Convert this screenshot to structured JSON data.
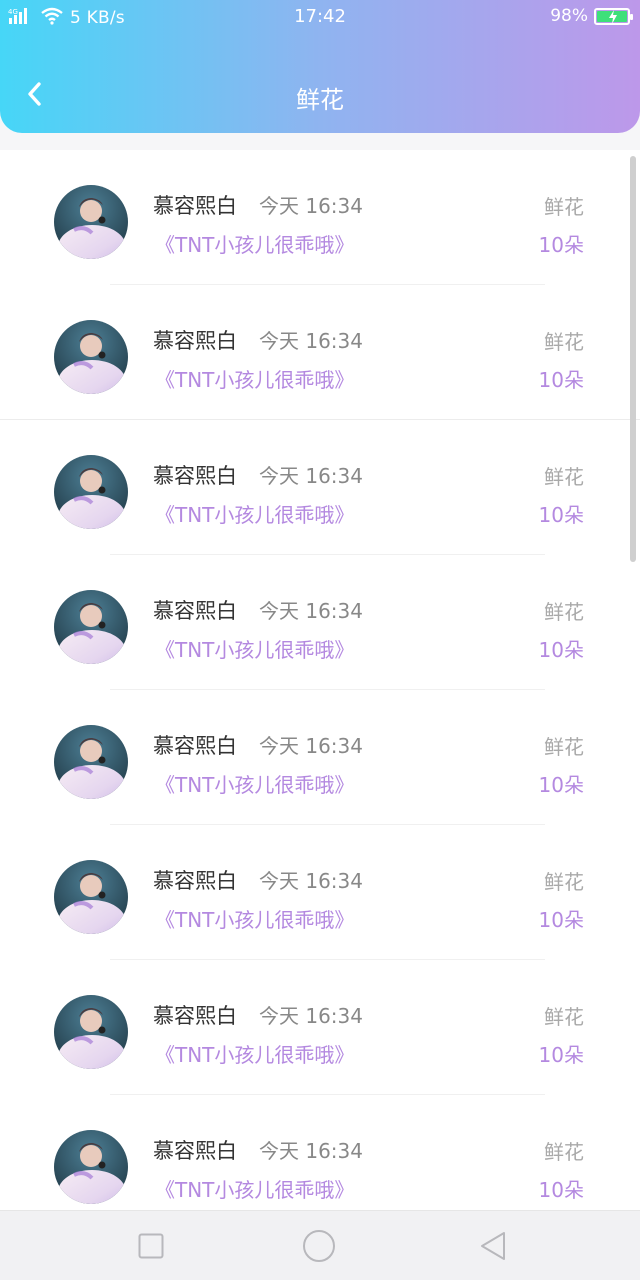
{
  "status_bar": {
    "network_label": "5 KB/s",
    "signal_tag": "4G",
    "time": "17:42",
    "battery_percent": "98%"
  },
  "header": {
    "title": "鲜花",
    "gradient": [
      "#46d6f7",
      "#8fb4f0",
      "#bd98ea"
    ]
  },
  "colors": {
    "accent": "#b489e0",
    "muted": "#a9a9a9",
    "text": "#333333"
  },
  "list": {
    "items": [
      {
        "name": "慕容熙白",
        "time": "今天 16:34",
        "novel": "《TNT小孩儿很乖哦》",
        "label": "鲜花",
        "count": "10朵"
      },
      {
        "name": "慕容熙白",
        "time": "今天 16:34",
        "novel": "《TNT小孩儿很乖哦》",
        "label": "鲜花",
        "count": "10朵"
      },
      {
        "name": "慕容熙白",
        "time": "今天 16:34",
        "novel": "《TNT小孩儿很乖哦》",
        "label": "鲜花",
        "count": "10朵"
      },
      {
        "name": "慕容熙白",
        "time": "今天 16:34",
        "novel": "《TNT小孩儿很乖哦》",
        "label": "鲜花",
        "count": "10朵"
      },
      {
        "name": "慕容熙白",
        "time": "今天 16:34",
        "novel": "《TNT小孩儿很乖哦》",
        "label": "鲜花",
        "count": "10朵"
      },
      {
        "name": "慕容熙白",
        "time": "今天 16:34",
        "novel": "《TNT小孩儿很乖哦》",
        "label": "鲜花",
        "count": "10朵"
      },
      {
        "name": "慕容熙白",
        "time": "今天 16:34",
        "novel": "《TNT小孩儿很乖哦》",
        "label": "鲜花",
        "count": "10朵"
      },
      {
        "name": "慕容熙白",
        "time": "今天 16:34",
        "novel": "《TNT小孩儿很乖哦》",
        "label": "鲜花",
        "count": "10朵"
      }
    ]
  },
  "nav_bar": {
    "icons": [
      "recent-apps-icon",
      "home-icon",
      "back-triangle-icon"
    ]
  }
}
